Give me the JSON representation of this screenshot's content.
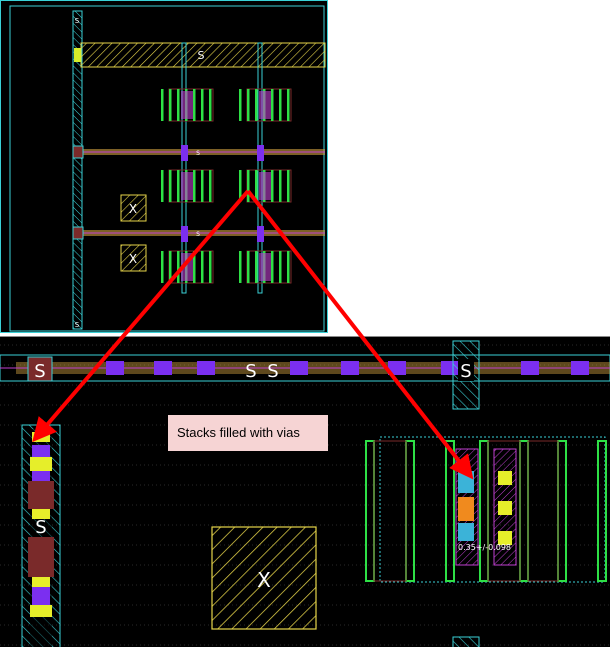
{
  "callout": {
    "text": "Stacks filled with vias"
  },
  "labels": {
    "source": "S",
    "blocked": "X",
    "measure": "0.35+/-0.098"
  },
  "colors": {
    "background": "#000000",
    "cyan": "#3ad1d6",
    "green": "#2ee046",
    "yellow": "#e6d44a",
    "purple": "#7b2ff0",
    "magenta": "#c03fd0",
    "brown": "#7a2a2a",
    "arrow": "#ff0000",
    "callout_bg": "#f6d4d4"
  }
}
